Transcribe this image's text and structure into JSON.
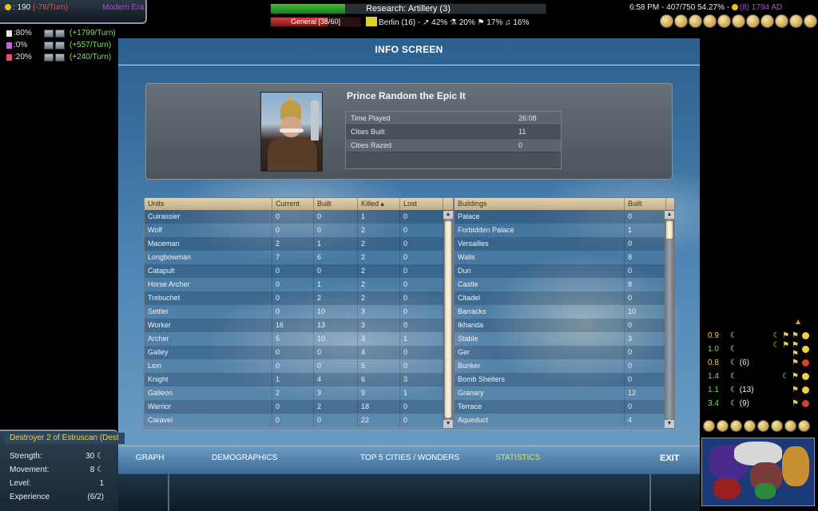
{
  "hud": {
    "gold": ": 190",
    "gold_rate": "(-78/Turn)",
    "era": "Modern Era",
    "rates": [
      {
        "pct": ":80%",
        "per_turn": "(+1799/Turn)",
        "color": "#e8e8e8"
      },
      {
        "pct": ":0%",
        "per_turn": "(+557/Turn)",
        "color": "#c860e0"
      },
      {
        "pct": ":20%",
        "per_turn": "(+240/Turn)",
        "color": "#e05080"
      }
    ],
    "research_text": "Research: Artillery (3)",
    "research_progress": 0.27,
    "general_text": "General [38/60]",
    "general_progress": 0.63,
    "city_text": "Berlin (16) - ↗ 42% ⚗ 20% ⚑ 17% ♫ 16%",
    "clock_text": "6:58 PM - 407/750 54.27% - ",
    "era_cost": "(8) 1794 AD"
  },
  "dialog": {
    "title": "INFO SCREEN",
    "leader_name": "Prince Random the Epic It",
    "stats": [
      {
        "label": "Time Played",
        "value": "26:08"
      },
      {
        "label": "Cities Built",
        "value": "11"
      },
      {
        "label": "Cities Razed",
        "value": "0"
      }
    ],
    "units_headers": [
      "Units",
      "Current",
      "Built",
      "Killed ▴",
      "Lost"
    ],
    "units": [
      [
        "Cuirassier",
        "0",
        "0",
        "1",
        "0"
      ],
      [
        "Wolf",
        "0",
        "0",
        "2",
        "0"
      ],
      [
        "Maceman",
        "2",
        "1",
        "2",
        "0"
      ],
      [
        "Longbowman",
        "7",
        "6",
        "2",
        "0"
      ],
      [
        "Catapult",
        "0",
        "0",
        "2",
        "0"
      ],
      [
        "Horse Archer",
        "0",
        "1",
        "2",
        "0"
      ],
      [
        "Trebuchet",
        "0",
        "2",
        "2",
        "0"
      ],
      [
        "Settler",
        "0",
        "10",
        "3",
        "0"
      ],
      [
        "Worker",
        "16",
        "13",
        "3",
        "0"
      ],
      [
        "Archer",
        "5",
        "10",
        "3",
        "1"
      ],
      [
        "Galley",
        "0",
        "0",
        "4",
        "0"
      ],
      [
        "Lion",
        "0",
        "0",
        "5",
        "0"
      ],
      [
        "Knight",
        "1",
        "4",
        "6",
        "3"
      ],
      [
        "Galleon",
        "2",
        "3",
        "9",
        "1"
      ],
      [
        "Warrior",
        "0",
        "2",
        "18",
        "0"
      ],
      [
        "Caravel",
        "0",
        "0",
        "22",
        "0"
      ]
    ],
    "buildings_headers": [
      "Buildings",
      "Built"
    ],
    "buildings": [
      [
        "Palace",
        "0"
      ],
      [
        "Forbidden Palace",
        "1"
      ],
      [
        "Versailles",
        "0"
      ],
      [
        "Walls",
        "8"
      ],
      [
        "Dun",
        "0"
      ],
      [
        "Castle",
        "8"
      ],
      [
        "Citadel",
        "0"
      ],
      [
        "Barracks",
        "10"
      ],
      [
        "Ikhanda",
        "0"
      ],
      [
        "Stable",
        "3"
      ],
      [
        "Ger",
        "0"
      ],
      [
        "Bunker",
        "0"
      ],
      [
        "Bomb Shelters",
        "0"
      ],
      [
        "Granary",
        "12"
      ],
      [
        "Terrace",
        "0"
      ],
      [
        "Aqueduct",
        "4"
      ]
    ],
    "tabs": {
      "graph": "GRAPH",
      "demographics": "DEMOGRAPHICS",
      "top5": "TOP 5 CITIES / WONDERS",
      "statistics": "STATISTICS",
      "exit": "EXIT"
    }
  },
  "unit_panel": {
    "title": "Destroyer 2 of Estruscan (Dest",
    "rows": [
      {
        "label": "Strength:",
        "value": "30 ☾"
      },
      {
        "label": "Movement:",
        "value": "8 ☾"
      },
      {
        "label": "Level:",
        "value": "1"
      },
      {
        "label": "Experience",
        "value": "(6/2)"
      }
    ]
  },
  "scoreboard": [
    {
      "score": "0.9",
      "mid": "☾",
      "extra": "",
      "syms": "☾ ⚑ ⚑",
      "color": "yellow",
      "face": "yellow"
    },
    {
      "score": "1.0",
      "mid": "☾",
      "extra": "",
      "syms": "☾ ⚑ ⚑ ⚑",
      "color": "green",
      "face": "yellow"
    },
    {
      "score": "0.8",
      "mid": "☾",
      "extra": "(6)",
      "syms": "⚑",
      "color": "yellow",
      "face": "red"
    },
    {
      "score": "1.4",
      "mid": "☾",
      "extra": "",
      "syms": "☾ ⚑",
      "color": "green",
      "face": "yellow"
    },
    {
      "score": "1.1",
      "mid": "☾",
      "extra": "(13)",
      "syms": "⚑",
      "color": "green",
      "face": "yellow"
    },
    {
      "score": "3.4",
      "mid": "☾",
      "extra": "(9)",
      "syms": "⚑",
      "color": "green",
      "face": "red"
    }
  ]
}
